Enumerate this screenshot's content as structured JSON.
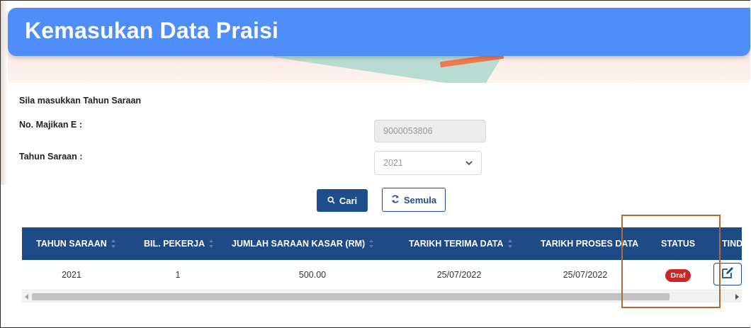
{
  "page": {
    "title": "Kemasukan Data Praisi"
  },
  "form": {
    "instruction": "Sila masukkan Tahun Saraan",
    "employer_label": "No. Majikan E :",
    "employer_value": "9000053806",
    "year_label": "Tahun Saraan :",
    "year_selected": "2021"
  },
  "buttons": {
    "search_label": "Cari",
    "reset_label": "Semula"
  },
  "table": {
    "headers": [
      "TAHUN SARAAN",
      "BIL. PEKERJA",
      "JUMLAH SARAAN KASAR (RM)",
      "TARIKH TERIMA DATA",
      "TARIKH PROSES DATA",
      "STATUS",
      "TIND"
    ],
    "rows": [
      {
        "tahun": "2021",
        "bil": "1",
        "jumlah": "500.00",
        "terima": "25/07/2022",
        "proses": "25/07/2022",
        "status": "Draf"
      }
    ]
  },
  "icons": {
    "search": "search-icon",
    "reset": "refresh-icon",
    "edit": "edit-icon",
    "sort": "sort-icon",
    "select": "chevron-down-icon"
  },
  "colors": {
    "title_bar": "#4f8df9",
    "table_header": "#1e4a86",
    "button_primary": "#1f4e8c",
    "status_draft": "#c62828",
    "highlight": "#b06a35"
  }
}
